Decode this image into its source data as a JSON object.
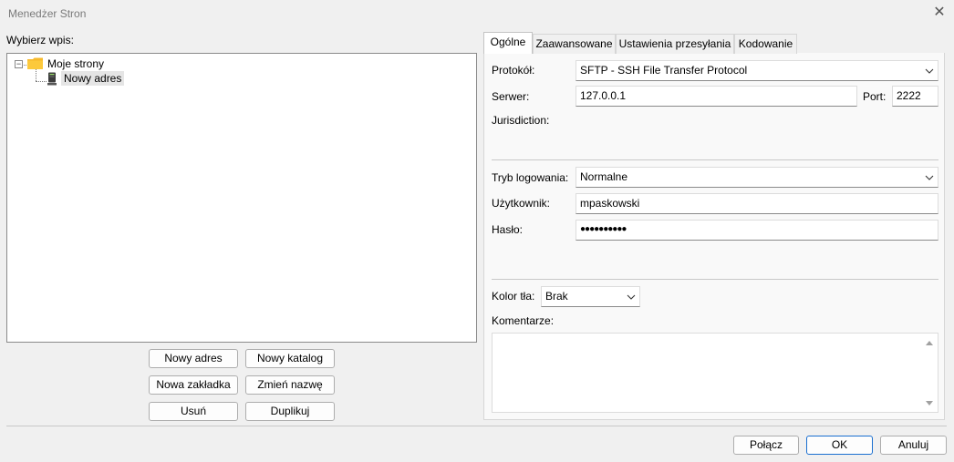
{
  "window": {
    "title": "Menedżer Stron",
    "close_label": "✕"
  },
  "left": {
    "label": "Wybierz wpis:",
    "tree": {
      "root_label": "Moje strony",
      "expander": "−",
      "child_label": "Nowy adres"
    },
    "buttons": {
      "new_site": "Nowy adres",
      "new_folder": "Nowy katalog",
      "new_bookmark": "Nowa zakładka",
      "rename": "Zmień nazwę",
      "delete": "Usuń",
      "duplicate": "Duplikuj"
    }
  },
  "tabs": [
    {
      "label": "Ogólne"
    },
    {
      "label": "Zaawansowane"
    },
    {
      "label": "Ustawienia przesyłania"
    },
    {
      "label": "Kodowanie"
    }
  ],
  "general": {
    "protocol_label": "Protokół:",
    "protocol_value": "SFTP - SSH File Transfer Protocol",
    "server_label": "Serwer:",
    "server_value": "127.0.0.1",
    "port_label": "Port:",
    "port_value": "2222",
    "jurisdiction_label": "Jurisdiction:",
    "logon_label": "Tryb logowania:",
    "logon_value": "Normalne",
    "user_label": "Użytkownik:",
    "user_value": "mpaskowski",
    "password_label": "Hasło:",
    "password_value": "●●●●●●●●●●",
    "bgcolor_label": "Kolor tła:",
    "bgcolor_value": "Brak",
    "comments_label": "Komentarze:"
  },
  "footer": {
    "connect": "Połącz",
    "ok": "OK",
    "cancel": "Anuluj"
  }
}
